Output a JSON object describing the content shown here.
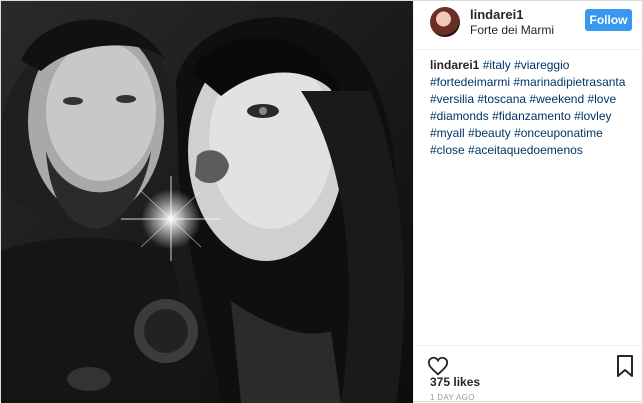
{
  "post": {
    "username": "lindarei1",
    "location": "Forte dei Marmi",
    "follow_label": "Follow",
    "caption_user": "lindarei1",
    "hashtags": [
      "#italy",
      "#viareggio",
      "#fortedeimarmi",
      "#marinadipietrasanta",
      "#versilia",
      "#toscana",
      "#weekend",
      "#love",
      "#diamonds",
      "#fidanzamento",
      "#lovley",
      "#myall",
      "#beauty",
      "#onceuponatime",
      "#close",
      "#aceitaquedoemenos"
    ],
    "likes": "375 likes",
    "time_ago": "1 DAY AGO"
  },
  "icons": {
    "like": "heart-icon",
    "save": "bookmark-icon",
    "avatar": "user-avatar"
  },
  "colors": {
    "follow_button": "#3897f0",
    "hashtag": "#003569",
    "text": "#262626",
    "muted": "#999999"
  }
}
